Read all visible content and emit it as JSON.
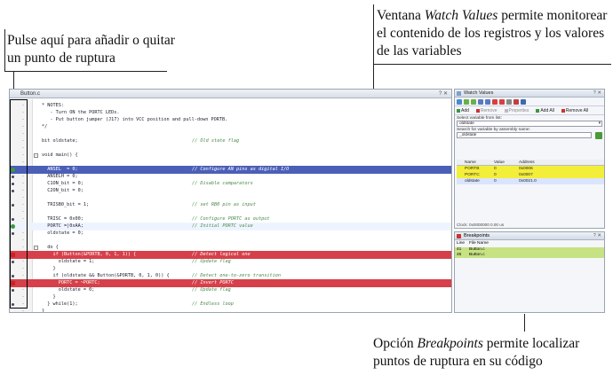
{
  "callouts": {
    "breakpoint_toggle": "Pulse aquí para añadir o quitar un punto de ruptura",
    "watch_values_pre": "Ventana ",
    "watch_values_em": "Watch Values",
    "watch_values_post": " permite monitorear el contenido de los registros y los valores de las variables",
    "breakpoints_pre": "Opción ",
    "breakpoints_em": "Breakpoints",
    "breakpoints_post": " permite localizar puntos de ruptura en su código"
  },
  "editor": {
    "tab_title": "Button.c",
    "lines": [
      {
        "code": "* NOTES:",
        "comment": "",
        "style": "normal",
        "marker": ""
      },
      {
        "code": "   - Turn ON the PORTC LEDs.",
        "comment": "",
        "style": "normal",
        "marker": ""
      },
      {
        "code": "   - Put button jumper (J17) into VCC position and pull-down PORTB.",
        "comment": "",
        "style": "normal",
        "marker": ""
      },
      {
        "code": "*/",
        "comment": "",
        "style": "normal",
        "marker": ""
      },
      {
        "code": "",
        "comment": "",
        "style": "normal",
        "marker": ""
      },
      {
        "code": "bit oldstate;",
        "comment": "// Old state flag",
        "style": "normal",
        "marker": ""
      },
      {
        "code": "",
        "comment": "",
        "style": "normal",
        "marker": ""
      },
      {
        "code": "void main() {",
        "comment": "",
        "style": "normal",
        "marker": "fold"
      },
      {
        "code": "",
        "comment": "",
        "style": "normal",
        "marker": ""
      },
      {
        "code": "  ANSEL  = 0;",
        "comment": "// Configure AN pins as digital I/O",
        "style": "blue",
        "marker": "g"
      },
      {
        "code": "  ANSELH = 0;",
        "comment": "",
        "style": "normal",
        "marker": "b"
      },
      {
        "code": "  C1ON_bit = 0;",
        "comment": "// Disable comparators",
        "style": "normal",
        "marker": "b"
      },
      {
        "code": "  C2ON_bit = 0;",
        "comment": "",
        "style": "normal",
        "marker": "b"
      },
      {
        "code": "",
        "comment": "",
        "style": "normal",
        "marker": ""
      },
      {
        "code": "  TRISB0_bit = 1;",
        "comment": "// set RB0 pin as input",
        "style": "normal",
        "marker": "b"
      },
      {
        "code": "",
        "comment": "",
        "style": "normal",
        "marker": ""
      },
      {
        "code": "  TRISC = 0x00;",
        "comment": "// Configure PORTC as output",
        "style": "normal",
        "marker": "b"
      },
      {
        "code": "  PORTC =|0xAA;",
        "comment": "// Initial PORTC value",
        "style": "cur",
        "marker": "g"
      },
      {
        "code": "  oldstate = 0;",
        "comment": "",
        "style": "normal",
        "marker": "b"
      },
      {
        "code": "",
        "comment": "",
        "style": "normal",
        "marker": ""
      },
      {
        "code": "  do {",
        "comment": "",
        "style": "normal",
        "marker": "fold"
      },
      {
        "code": "    if (Button(&PORTB, 0, 1, 1)) {",
        "comment": "// Detect logical one",
        "style": "red",
        "marker": "r"
      },
      {
        "code": "      oldstate = 1;",
        "comment": "// Update flag",
        "style": "normal",
        "marker": "b"
      },
      {
        "code": "    }",
        "comment": "",
        "style": "normal",
        "marker": ""
      },
      {
        "code": "    if (oldstate && Button(&PORTB, 0, 1, 0)) {",
        "comment": "// Detect one-to-zero transition",
        "style": "normal",
        "marker": "b"
      },
      {
        "code": "      PORTC = ~PORTC;",
        "comment": "// Invert PORTC",
        "style": "red",
        "marker": "r"
      },
      {
        "code": "      oldstate = 0;",
        "comment": "// Update flag",
        "style": "normal",
        "marker": "b"
      },
      {
        "code": "    }",
        "comment": "",
        "style": "normal",
        "marker": ""
      },
      {
        "code": "  } while(1);",
        "comment": "// Endless loop",
        "style": "normal",
        "marker": "b"
      },
      {
        "code": "}",
        "comment": "",
        "style": "normal",
        "marker": ""
      }
    ]
  },
  "watch": {
    "title": "Watch Values",
    "actions": [
      "Add",
      "Remove",
      "Properties",
      "Add All",
      "Remove All"
    ],
    "select_label": "Select variable from list:",
    "select_value": "oldstate",
    "search_label": "Search for variable by assembly name:",
    "search_value": "_oldstate",
    "columns": [
      "Name",
      "Value",
      "Address"
    ],
    "rows": [
      {
        "name": "PORTB",
        "value": "0",
        "address": "0x0006",
        "style": "yel"
      },
      {
        "name": "PORTC",
        "value": "0",
        "address": "0x0007",
        "style": "yel"
      },
      {
        "name": "oldstate",
        "value": "0",
        "address": "0x0021.0",
        "style": "sel"
      }
    ],
    "status": "Clock:  0x0000000        0.00 us"
  },
  "breakpoints": {
    "title": "Breakpoints",
    "columns": [
      "Line",
      "File Name"
    ],
    "rows": [
      {
        "line": "41",
        "file": "Button.c"
      },
      {
        "line": "45",
        "file": "Button.c"
      }
    ]
  }
}
